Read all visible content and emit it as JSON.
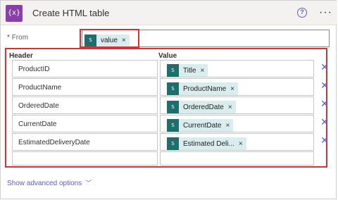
{
  "header": {
    "icon_text": "{x}",
    "title": "Create HTML table",
    "help_icon": "?",
    "more_icon": "···"
  },
  "from": {
    "required_mark": "*",
    "label": "From",
    "token": {
      "label": "value",
      "icon": "sharepoint-icon",
      "icon_text": "S"
    }
  },
  "table": {
    "header_col": "Header",
    "value_col": "Value",
    "rows": [
      {
        "header": "ProductID",
        "value": "Title"
      },
      {
        "header": "ProductName",
        "value": "ProductName"
      },
      {
        "header": "OrderedDate",
        "value": "OrderedDate"
      },
      {
        "header": "CurrentDate",
        "value": "CurrentDate"
      },
      {
        "header": "EstimatedDeliveryDate",
        "value": "Estimated Deli..."
      },
      {
        "header": "",
        "value": ""
      }
    ]
  },
  "footer": {
    "advanced_label": "Show advanced options",
    "chevron": "﹀"
  },
  "token_remove": "×",
  "row_delete": "✕",
  "colors": {
    "accent": "#5b5fc7",
    "highlight": "#d13438",
    "token_bg": "#d9ecee",
    "token_icon_bg": "#1f6e6e",
    "action_icon_bg": "#8a3ea7"
  }
}
